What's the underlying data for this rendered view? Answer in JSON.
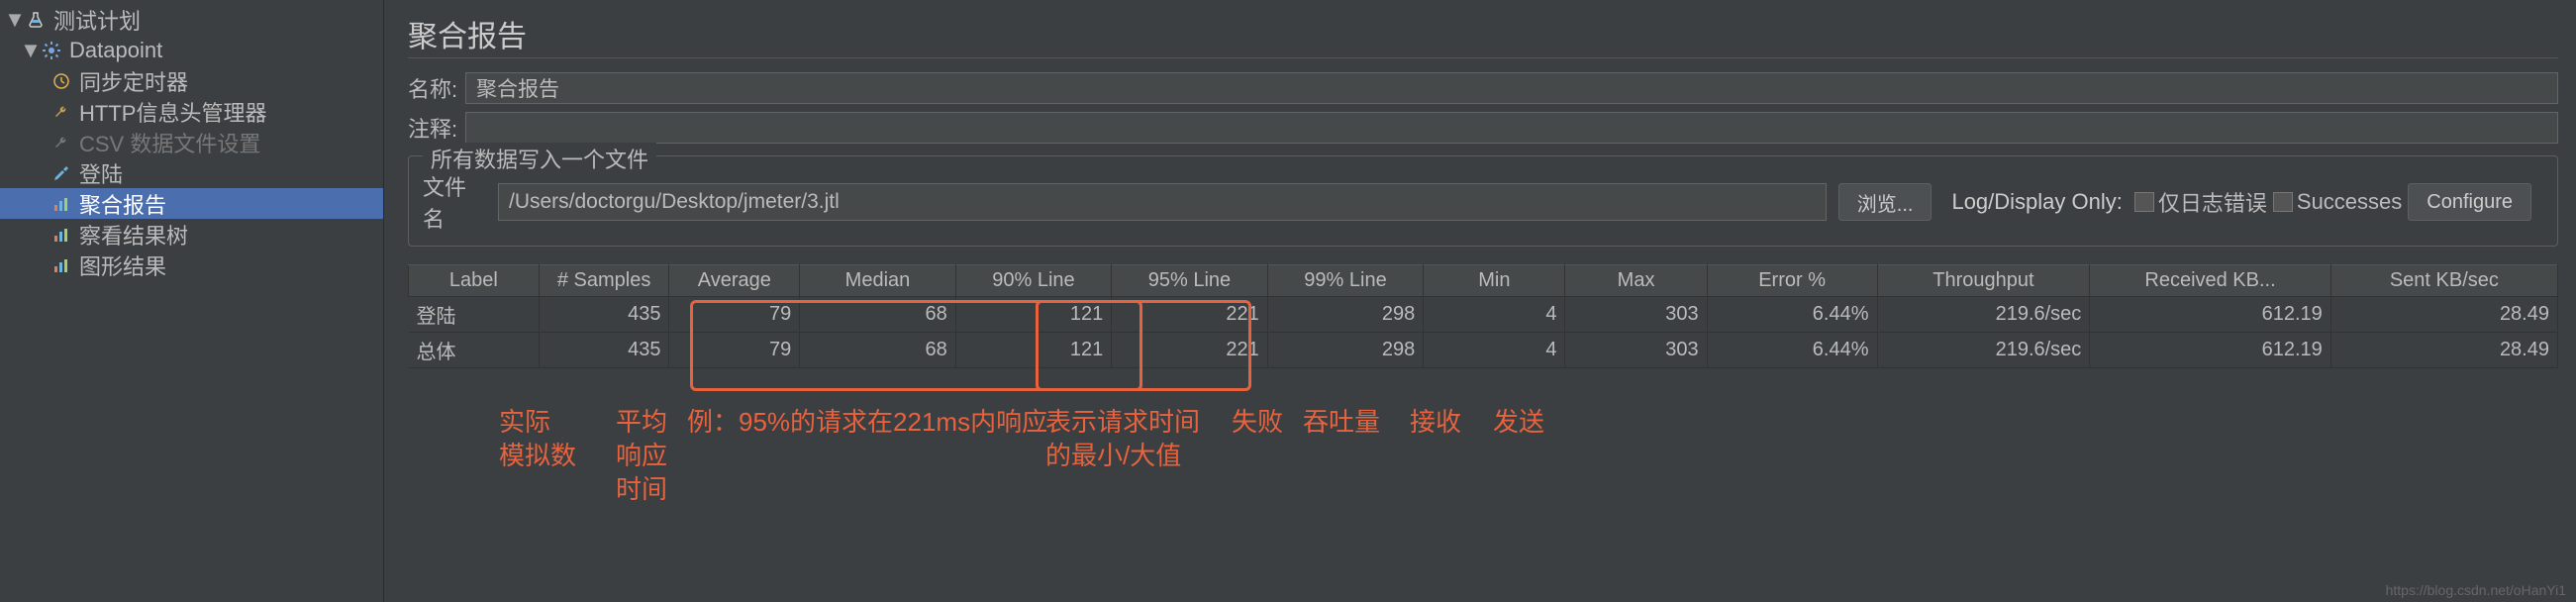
{
  "tree": {
    "root": "测试计划",
    "datapoint": "Datapoint",
    "items": [
      "同步定时器",
      "HTTP信息头管理器",
      "CSV 数据文件设置",
      "登陆",
      "聚合报告",
      "察看结果树",
      "图形结果"
    ]
  },
  "page_title": "聚合报告",
  "fields": {
    "name_label": "名称:",
    "name_value": "聚合报告",
    "comment_label": "注释:",
    "comment_value": ""
  },
  "file_group": {
    "title": "所有数据写入一个文件",
    "filename_label": "文件名",
    "filename_value": "/Users/doctorgu/Desktop/jmeter/3.jtl",
    "browse": "浏览...",
    "log_display": "Log/Display Only:",
    "errors_only": "仅日志错误",
    "successes": "Successes",
    "configure": "Configure"
  },
  "table": {
    "headers": [
      "Label",
      "# Samples",
      "Average",
      "Median",
      "90% Line",
      "95% Line",
      "99% Line",
      "Min",
      "Max",
      "Error %",
      "Throughput",
      "Received KB...",
      "Sent KB/sec"
    ],
    "rows": [
      [
        "登陆",
        "435",
        "79",
        "68",
        "121",
        "221",
        "298",
        "4",
        "303",
        "6.44%",
        "219.6/sec",
        "612.19",
        "28.49"
      ],
      [
        "总体",
        "435",
        "79",
        "68",
        "121",
        "221",
        "298",
        "4",
        "303",
        "6.44%",
        "219.6/sec",
        "612.19",
        "28.49"
      ]
    ]
  },
  "annotations": {
    "a1": "实际\n模拟数",
    "a2": "平均\n响应\n时间",
    "a3": "例：95%的请求在221ms内响应",
    "a4": "表示请求时间\n的最小/大值",
    "a5": "失败",
    "a6": "吞吐量",
    "a7": "接收",
    "a8": "发送"
  },
  "watermark": "https://blog.csdn.net/oHanYi1"
}
